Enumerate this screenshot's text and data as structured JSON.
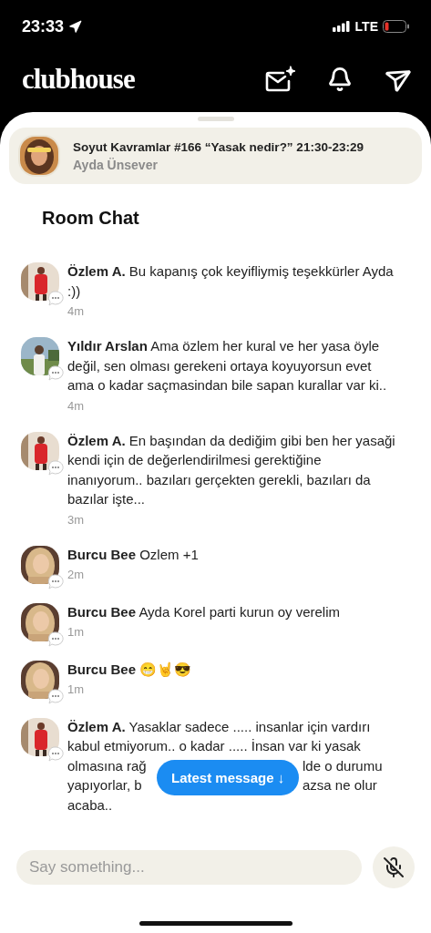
{
  "status_bar": {
    "time": "23:33",
    "network": "LTE"
  },
  "header": {
    "logo": "clubhouse"
  },
  "room": {
    "title": "Soyut Kavramlar #166 “Yasak nedir?” 21:30-23:29",
    "host": "Ayda Ünsever"
  },
  "chat": {
    "title": "Room Chat",
    "messages": [
      {
        "kind": "text",
        "author": "Özlem A.",
        "text": "Bu kapanış çok keyifliymiş teşekkürler Ayda :))",
        "time": "4m"
      },
      {
        "kind": "text",
        "author": "Yıldır Arslan",
        "text": "Ama özlem her kural ve her yasa öyle değil, sen olması gerekeni ortaya koyuyorsun evet ama o kadar saçmasindan bile sapan kurallar var ki..",
        "time": "4m"
      },
      {
        "kind": "text",
        "author": "Özlem A.",
        "text": "En başından da dediğim gibi ben her yasaği kendi için de değerlendirilmesi gerektiğine inanıyorum.. bazıları gerçekten gerekli, bazıları da bazılar işte...",
        "time": "3m"
      },
      {
        "kind": "text",
        "author": "Burcu Bee",
        "text": "Ozlem +1",
        "time": "2m"
      },
      {
        "kind": "text",
        "author": "Burcu Bee",
        "text": "Ayda Korel parti kurun oy verelim",
        "time": "1m"
      },
      {
        "kind": "text",
        "author": "Burcu Bee",
        "text": "😁🤘😎",
        "time": "1m"
      },
      {
        "kind": "covered",
        "author": "Özlem A.",
        "lines": [
          [
            "Yasaklar sadece ..... insanlar için vardırı"
          ],
          [
            "kabul etmiyorum.. o kadar ..... İnsan var ki yasak"
          ],
          [
            "olmasına rağ",
            "lde o durumu"
          ],
          [
            "yapıyorlar, b",
            "azsa ne olur"
          ],
          [
            "acaba.."
          ]
        ]
      }
    ],
    "latest_button": "Latest message ↓"
  },
  "composer": {
    "placeholder": "Say something..."
  }
}
